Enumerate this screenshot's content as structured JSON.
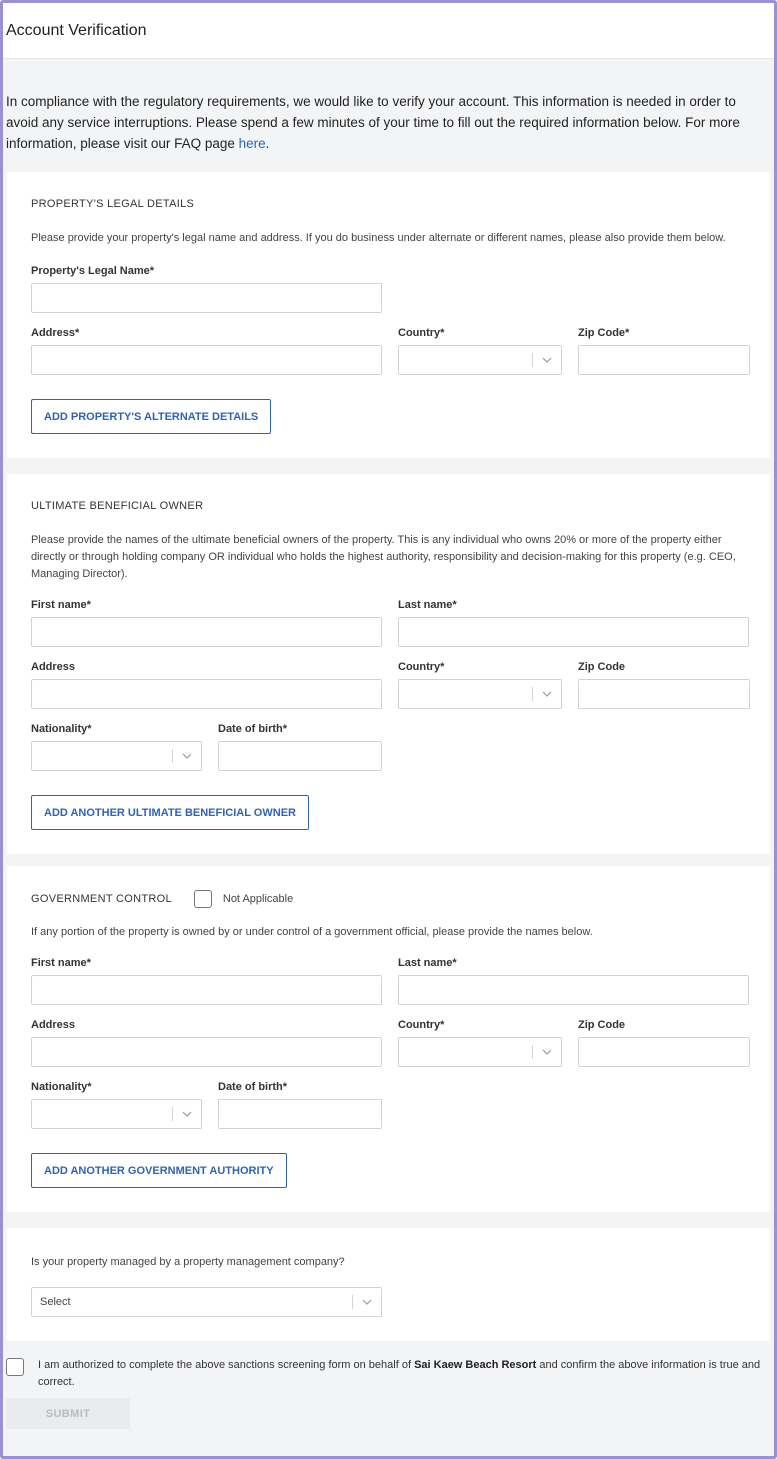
{
  "header": {
    "title": "Account Verification"
  },
  "intro": {
    "text": "In compliance with the regulatory requirements, we would like to verify your account. This information is needed in order to avoid any service interruptions. Please spend a few minutes of your time to fill out the required information below. For more information, please visit our FAQ page ",
    "link": "here",
    "trailing": "."
  },
  "legal": {
    "title": "PROPERTY'S LEGAL DETAILS",
    "desc": "Please provide your property's legal name and address. If you do business under alternate or different names, please also provide them below.",
    "legal_name_label": "Property's Legal Name*",
    "address_label": "Address*",
    "country_label": "Country*",
    "zip_label": "Zip Code*",
    "add_button": "ADD PROPERTY'S ALTERNATE DETAILS"
  },
  "ubo": {
    "title": "ULTIMATE BENEFICIAL OWNER",
    "desc": "Please provide the names of the ultimate beneficial owners of the property. This is any individual who owns 20% or more of the property either directly or through holding company OR individual who holds the highest authority, responsibility and decision-making for this property (e.g. CEO, Managing Director).",
    "first_label": "First name*",
    "last_label": "Last name*",
    "address_label": "Address",
    "country_label": "Country*",
    "zip_label": "Zip Code",
    "nationality_label": "Nationality*",
    "dob_label": "Date of birth*",
    "add_button": "ADD ANOTHER ULTIMATE BENEFICIAL OWNER"
  },
  "gov": {
    "title": "GOVERNMENT CONTROL",
    "na_label": "Not Applicable",
    "desc": "If any portion of the property is owned by or under control of a government official, please provide the names below.",
    "first_label": "First name*",
    "last_label": "Last name*",
    "address_label": "Address",
    "country_label": "Country*",
    "zip_label": "Zip Code",
    "nationality_label": "Nationality*",
    "dob_label": "Date of birth*",
    "add_button": "ADD ANOTHER GOVERNMENT AUTHORITY"
  },
  "management": {
    "question": "Is your property managed by a property management company?",
    "select_value": "Select"
  },
  "authorization": {
    "text_before": "I am authorized to complete the above sanctions screening form on behalf of ",
    "property": "Sai Kaew Beach Resort",
    "text_after": " and confirm the above information is true and correct."
  },
  "submit_label": "SUBMIT"
}
